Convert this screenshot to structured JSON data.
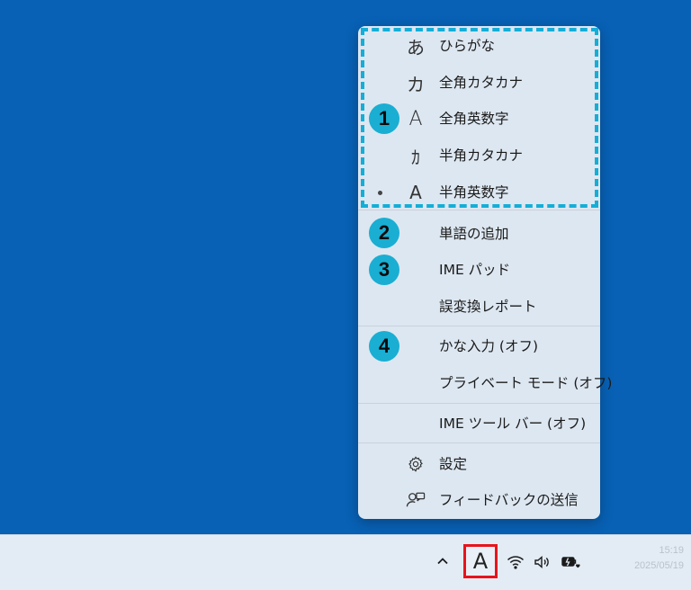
{
  "ime_menu": {
    "input_modes": [
      {
        "icon_char": "あ",
        "label": "ひらがな",
        "selected": false
      },
      {
        "icon_char": "カ",
        "label": "全角カタカナ",
        "selected": false
      },
      {
        "icon_char": "A",
        "label": "全角英数字",
        "selected": false
      },
      {
        "icon_char": "ｶ",
        "label": "半角カタカナ",
        "selected": false
      },
      {
        "icon_char": "A",
        "label": "半角英数字",
        "selected": true
      }
    ],
    "add_word": "単語の追加",
    "ime_pad": "IME パッド",
    "conversion_report": "誤変換レポート",
    "kana_input": "かな入力 (オフ)",
    "private_mode": "プライベート モード (オフ)",
    "ime_toolbar": "IME ツール バー (オフ)",
    "settings": "設定",
    "feedback": "フィードバックの送信"
  },
  "callouts": [
    "1",
    "2",
    "3",
    "4"
  ],
  "taskbar": {
    "ime_indicator": "A",
    "chevron_icon": "chevron-up-icon",
    "time": "15:19",
    "date": "2025/05/19"
  },
  "colors": {
    "desktop": "#0861b5",
    "menu_bg": "#dde7f1",
    "callout": "#1aaed3",
    "highlight_box": "#e8141c"
  }
}
